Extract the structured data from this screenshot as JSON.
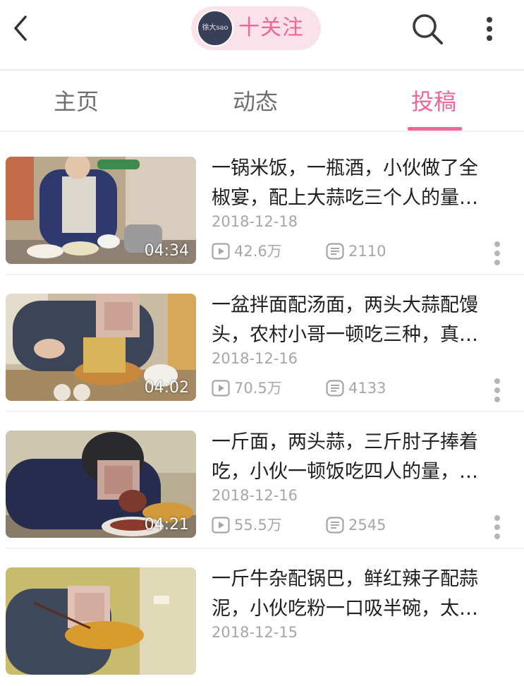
{
  "header": {
    "avatar_text": "徐大sao",
    "follow_label": "十关注",
    "colors": {
      "accent": "#f06793",
      "pill_bg": "#fbe1ea"
    }
  },
  "tabs": [
    {
      "label": "主页",
      "active": false
    },
    {
      "label": "动态",
      "active": false
    },
    {
      "label": "投稿",
      "active": true
    }
  ],
  "videos": [
    {
      "title_line1": "一锅米饭，一瓶酒，小伙做了全",
      "title_line2": "椒宴，配上大蒜吃三个人的量…",
      "date": "2018-12-18",
      "duration": "04:34",
      "views": "42.6万",
      "danmaku": "2110"
    },
    {
      "title_line1": "一盆拌面配汤面，两头大蒜配馒",
      "title_line2": "头，农村小哥一顿吃三种，真…",
      "date": "2018-12-16",
      "duration": "04:02",
      "views": "70.5万",
      "danmaku": "4133"
    },
    {
      "title_line1": "一斤面，两头蒜，三斤肘子捧着",
      "title_line2": "吃，小伙一顿饭吃四人的量，…",
      "date": "2018-12-16",
      "duration": "04:21",
      "views": "55.5万",
      "danmaku": "2545"
    },
    {
      "title_line1": "一斤牛杂配锅巴，鲜红辣子配蒜",
      "title_line2": "泥，小伙吃粉一口吸半碗，太…",
      "date": "2018-12-15",
      "duration": "",
      "views": "",
      "danmaku": ""
    }
  ],
  "icons": {
    "back": "back-arrow-icon",
    "search": "search-icon",
    "more": "more-vertical-icon",
    "play": "play-count-icon",
    "danmaku": "danmaku-icon"
  }
}
